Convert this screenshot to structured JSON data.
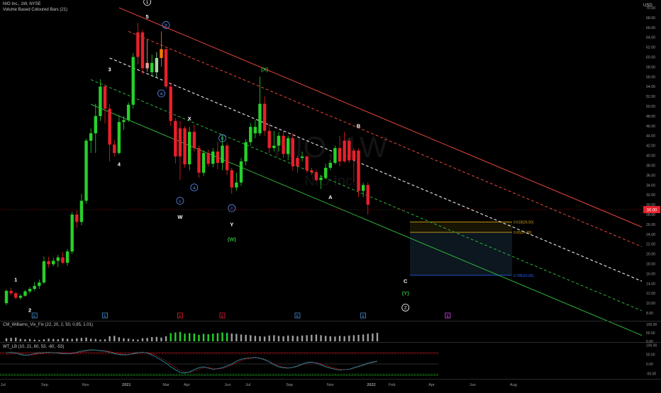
{
  "header": {
    "title": "NIO Inc., 1W, NYSE",
    "indicator": "Volume Based Coloured Bars (21)",
    "currency": "USD"
  },
  "watermark": {
    "symbol": "NIO, 1W",
    "name": "NIO Inc."
  },
  "colors": {
    "background": "#000000",
    "bull": "#26d12a",
    "bear": "#e8202a",
    "bull_pale": "#a5d6a7",
    "bear_pale": "#ef9a9a",
    "orange": "#f57c00",
    "channel_red": "#e8463c",
    "channel_white": "#ffffff",
    "channel_green": "#2fb03a",
    "fib": "#d4a017",
    "fib_blue": "#2962ff",
    "price_tag": "#e8202a"
  },
  "chart_data": {
    "type": "candlestick",
    "interval": "1W",
    "x_start": "2020-07-06",
    "y_axis": {
      "ylim": [
        7,
        71
      ],
      "ticks": [
        70,
        68,
        66,
        64,
        62,
        60,
        58,
        56,
        54,
        52,
        50,
        48,
        46,
        44,
        42,
        40,
        38,
        36,
        34,
        32,
        30,
        28,
        26,
        24,
        22,
        20,
        18,
        16,
        14,
        12,
        10,
        8
      ]
    },
    "x_axis": {
      "tick_labels": [
        {
          "label": "Jul",
          "date": "2020-07-01"
        },
        {
          "label": "Sep",
          "date": "2020-09-01"
        },
        {
          "label": "Nov",
          "date": "2020-11-01"
        },
        {
          "label": "2021",
          "date": "2021-01-01"
        },
        {
          "label": "Mar",
          "date": "2021-03-01"
        },
        {
          "label": "Apr",
          "date": "2021-04-01"
        },
        {
          "label": "Jun",
          "date": "2021-06-01"
        },
        {
          "label": "Jul",
          "date": "2021-07-01"
        },
        {
          "label": "Sep",
          "date": "2021-09-01"
        },
        {
          "label": "Nov",
          "date": "2021-11-01"
        },
        {
          "label": "2022",
          "date": "2022-01-01"
        },
        {
          "label": "Feb",
          "date": "2022-02-01"
        },
        {
          "label": "Apr",
          "date": "2022-04-01"
        },
        {
          "label": "Jun",
          "date": "2022-06-01"
        },
        {
          "label": "Aug",
          "date": "2022-08-01"
        }
      ]
    },
    "last_price": "30.00",
    "candles": [
      {
        "o": 10.0,
        "h": 12.8,
        "l": 9.6,
        "c": 12.5,
        "k": "bull"
      },
      {
        "o": 12.5,
        "h": 13.1,
        "l": 11.6,
        "c": 12.0,
        "k": "bear"
      },
      {
        "o": 12.0,
        "h": 12.3,
        "l": 10.8,
        "c": 11.1,
        "k": "bear"
      },
      {
        "o": 11.1,
        "h": 11.8,
        "l": 10.7,
        "c": 11.5,
        "k": "bull"
      },
      {
        "o": 11.5,
        "h": 12.7,
        "l": 11.3,
        "c": 12.4,
        "k": "bull"
      },
      {
        "o": 12.4,
        "h": 13.3,
        "l": 12.0,
        "c": 12.9,
        "k": "bull"
      },
      {
        "o": 12.9,
        "h": 14.3,
        "l": 12.5,
        "c": 13.5,
        "k": "bull"
      },
      {
        "o": 13.5,
        "h": 14.8,
        "l": 12.9,
        "c": 14.2,
        "k": "bull"
      },
      {
        "o": 14.2,
        "h": 19.5,
        "l": 13.9,
        "c": 18.5,
        "k": "bull"
      },
      {
        "o": 18.5,
        "h": 19.4,
        "l": 17.2,
        "c": 17.9,
        "k": "bear"
      },
      {
        "o": 17.9,
        "h": 19.2,
        "l": 17.5,
        "c": 18.6,
        "k": "bull"
      },
      {
        "o": 18.6,
        "h": 19.8,
        "l": 17.3,
        "c": 19.3,
        "k": "bull"
      },
      {
        "o": 19.3,
        "h": 20.4,
        "l": 17.9,
        "c": 18.2,
        "k": "bear"
      },
      {
        "o": 18.2,
        "h": 21.0,
        "l": 17.6,
        "c": 20.5,
        "k": "bull"
      },
      {
        "o": 20.5,
        "h": 28.5,
        "l": 20.0,
        "c": 28.0,
        "k": "bull"
      },
      {
        "o": 28.0,
        "h": 28.8,
        "l": 25.3,
        "c": 26.5,
        "k": "bear"
      },
      {
        "o": 26.5,
        "h": 32.2,
        "l": 25.8,
        "c": 30.8,
        "k": "bull"
      },
      {
        "o": 30.8,
        "h": 43.4,
        "l": 30.2,
        "c": 43.0,
        "k": "bull"
      },
      {
        "o": 43.0,
        "h": 45.5,
        "l": 40.5,
        "c": 44.5,
        "k": "bull"
      },
      {
        "o": 44.5,
        "h": 50.5,
        "l": 40.5,
        "c": 48.0,
        "k": "bull"
      },
      {
        "o": 48.0,
        "h": 55.5,
        "l": 47.0,
        "c": 54.0,
        "k": "bull"
      },
      {
        "o": 54.0,
        "h": 54.5,
        "l": 46.5,
        "c": 49.5,
        "k": "bear"
      },
      {
        "o": 49.5,
        "h": 50.5,
        "l": 38.8,
        "c": 42.2,
        "k": "bear"
      },
      {
        "o": 42.2,
        "h": 43.2,
        "l": 39.8,
        "c": 40.5,
        "k": "bear"
      },
      {
        "o": 40.5,
        "h": 48.2,
        "l": 40.2,
        "c": 46.8,
        "k": "bull"
      },
      {
        "o": 46.8,
        "h": 48.0,
        "l": 45.2,
        "c": 47.2,
        "k": "bull"
      },
      {
        "o": 47.2,
        "h": 50.8,
        "l": 46.8,
        "c": 50.3,
        "k": "bull"
      },
      {
        "o": 50.3,
        "h": 60.8,
        "l": 49.5,
        "c": 60.0,
        "k": "bull"
      },
      {
        "o": 60.0,
        "h": 66.9,
        "l": 58.5,
        "c": 65.0,
        "k": "bear"
      },
      {
        "o": 65.0,
        "h": 65.5,
        "l": 56.5,
        "c": 57.7,
        "k": "bear"
      },
      {
        "o": 57.7,
        "h": 63.5,
        "l": 57.0,
        "c": 58.8,
        "k": "pale_bear"
      },
      {
        "o": 58.8,
        "h": 60.5,
        "l": 56.0,
        "c": 56.9,
        "k": "bull"
      },
      {
        "o": 56.9,
        "h": 61.0,
        "l": 55.8,
        "c": 59.8,
        "k": "pale_bull"
      },
      {
        "o": 59.8,
        "h": 65.2,
        "l": 58.0,
        "c": 61.6,
        "k": "orange"
      },
      {
        "o": 61.6,
        "h": 61.7,
        "l": 53.6,
        "c": 54.0,
        "k": "bear"
      },
      {
        "o": 54.0,
        "h": 54.7,
        "l": 46.0,
        "c": 47.0,
        "k": "bear"
      },
      {
        "o": 47.0,
        "h": 47.6,
        "l": 38.4,
        "c": 39.8,
        "k": "bear"
      },
      {
        "o": 39.8,
        "h": 47.0,
        "l": 35.0,
        "c": 45.5,
        "k": "bear"
      },
      {
        "o": 45.5,
        "h": 46.0,
        "l": 37.5,
        "c": 38.2,
        "k": "bear"
      },
      {
        "o": 38.2,
        "h": 45.8,
        "l": 37.0,
        "c": 44.8,
        "k": "bull"
      },
      {
        "o": 44.8,
        "h": 46.3,
        "l": 40.8,
        "c": 41.5,
        "k": "bear"
      },
      {
        "o": 41.5,
        "h": 42.0,
        "l": 35.5,
        "c": 36.5,
        "k": "bear"
      },
      {
        "o": 36.5,
        "h": 41.0,
        "l": 35.8,
        "c": 40.5,
        "k": "bull"
      },
      {
        "o": 40.5,
        "h": 41.2,
        "l": 37.8,
        "c": 38.3,
        "k": "bear"
      },
      {
        "o": 38.3,
        "h": 41.5,
        "l": 37.6,
        "c": 40.8,
        "k": "bull"
      },
      {
        "o": 40.8,
        "h": 42.8,
        "l": 37.2,
        "c": 38.5,
        "k": "bear"
      },
      {
        "o": 38.5,
        "h": 44.2,
        "l": 37.0,
        "c": 42.0,
        "k": "bull"
      },
      {
        "o": 42.0,
        "h": 42.5,
        "l": 36.0,
        "c": 37.0,
        "k": "bear"
      },
      {
        "o": 37.0,
        "h": 37.5,
        "l": 32.2,
        "c": 33.5,
        "k": "bear"
      },
      {
        "o": 33.5,
        "h": 36.5,
        "l": 32.8,
        "c": 34.5,
        "k": "bull"
      },
      {
        "o": 34.5,
        "h": 39.5,
        "l": 33.8,
        "c": 38.8,
        "k": "bull"
      },
      {
        "o": 38.8,
        "h": 43.3,
        "l": 38.0,
        "c": 42.7,
        "k": "bull"
      },
      {
        "o": 42.7,
        "h": 46.6,
        "l": 42.0,
        "c": 45.8,
        "k": "bull"
      },
      {
        "o": 45.8,
        "h": 47.2,
        "l": 43.5,
        "c": 44.5,
        "k": "bull"
      },
      {
        "o": 44.5,
        "h": 56.0,
        "l": 44.0,
        "c": 50.5,
        "k": "bull"
      },
      {
        "o": 50.5,
        "h": 52.0,
        "l": 44.0,
        "c": 45.0,
        "k": "bear"
      },
      {
        "o": 45.0,
        "h": 46.5,
        "l": 40.5,
        "c": 41.5,
        "k": "bear"
      },
      {
        "o": 41.5,
        "h": 45.0,
        "l": 40.8,
        "c": 42.0,
        "k": "bull"
      },
      {
        "o": 42.0,
        "h": 44.7,
        "l": 40.8,
        "c": 44.0,
        "k": "bull"
      },
      {
        "o": 44.0,
        "h": 45.0,
        "l": 39.5,
        "c": 40.3,
        "k": "bear"
      },
      {
        "o": 40.3,
        "h": 44.0,
        "l": 39.0,
        "c": 43.5,
        "k": "bull"
      },
      {
        "o": 43.5,
        "h": 44.5,
        "l": 36.9,
        "c": 37.8,
        "k": "bear"
      },
      {
        "o": 37.8,
        "h": 40.0,
        "l": 36.5,
        "c": 39.5,
        "k": "bear"
      },
      {
        "o": 39.5,
        "h": 40.8,
        "l": 38.8,
        "c": 39.8,
        "k": "bull"
      },
      {
        "o": 39.8,
        "h": 40.0,
        "l": 36.5,
        "c": 37.0,
        "k": "bear"
      },
      {
        "o": 37.0,
        "h": 37.5,
        "l": 36.0,
        "c": 36.6,
        "k": "bear"
      },
      {
        "o": 36.6,
        "h": 37.1,
        "l": 34.8,
        "c": 35.0,
        "k": "bear"
      },
      {
        "o": 35.0,
        "h": 36.0,
        "l": 33.2,
        "c": 35.5,
        "k": "bull"
      },
      {
        "o": 35.5,
        "h": 38.3,
        "l": 35.2,
        "c": 37.5,
        "k": "bull"
      },
      {
        "o": 37.5,
        "h": 39.0,
        "l": 37.0,
        "c": 38.5,
        "k": "bull"
      },
      {
        "o": 38.5,
        "h": 42.0,
        "l": 38.2,
        "c": 41.5,
        "k": "bull"
      },
      {
        "o": 41.5,
        "h": 44.0,
        "l": 37.8,
        "c": 38.8,
        "k": "bear"
      },
      {
        "o": 38.8,
        "h": 44.8,
        "l": 38.5,
        "c": 43.0,
        "k": "bear"
      },
      {
        "o": 43.0,
        "h": 43.5,
        "l": 38.5,
        "c": 39.0,
        "k": "bear"
      },
      {
        "o": 39.0,
        "h": 41.5,
        "l": 34.5,
        "c": 41.0,
        "k": "bear"
      },
      {
        "o": 41.0,
        "h": 41.5,
        "l": 31.5,
        "c": 32.8,
        "k": "bear"
      },
      {
        "o": 32.8,
        "h": 34.5,
        "l": 31.5,
        "c": 34.0,
        "k": "bull"
      },
      {
        "o": 34.0,
        "h": 34.5,
        "l": 28.0,
        "c": 30.0,
        "k": "bear"
      }
    ],
    "channels": [
      {
        "name": "upper",
        "color": "#e8463c",
        "style": "solid",
        "y_at_0": 70.0,
        "slope_per_week": -0.4
      },
      {
        "name": "upper-mid",
        "color": "#e8463c",
        "style": "dashed",
        "y_at_0": 66.0,
        "slope_per_week": -0.4
      },
      {
        "name": "middle",
        "color": "#ffffff",
        "style": "dashed",
        "y_at_0": 59.0,
        "slope_per_week": -0.4
      },
      {
        "name": "lower-mid",
        "color": "#2fb03a",
        "style": "dashed",
        "y_at_0": 53.0,
        "slope_per_week": -0.4
      },
      {
        "name": "lower",
        "color": "#2fb03a",
        "style": "solid",
        "y_at_0": 48.0,
        "slope_per_week": -0.4
      }
    ],
    "fib_levels": [
      {
        "label": "0.618(26.50)",
        "value": 26.5,
        "color": "#d4a017"
      },
      {
        "label": "0.65(24.39)",
        "value": 24.39,
        "color": "#d4a017"
      },
      {
        "label": "0.786(15.66)",
        "value": 15.66,
        "color": "#2962ff"
      }
    ],
    "wave_labels": [
      {
        "t": "1",
        "i": 2,
        "y": 14.8,
        "c": "#ffffff",
        "s": "plain"
      },
      {
        "t": "2",
        "i": 5,
        "y": 8.6,
        "c": "#ffffff",
        "s": "plain"
      },
      {
        "t": "3",
        "i": 22,
        "y": 57.5,
        "c": "#ffffff",
        "s": "plain"
      },
      {
        "t": "4",
        "i": 24,
        "y": 38.2,
        "c": "#ffffff",
        "s": "plain"
      },
      {
        "t": "5",
        "i": 30,
        "y": 68.2,
        "c": "#ffffff",
        "s": "plain"
      },
      {
        "t": "1",
        "i": 30,
        "y": 71.2,
        "c": "#ffffff",
        "s": "circle"
      },
      {
        "t": "a",
        "i": 33,
        "y": 52.6,
        "c": "#5b8def",
        "s": "circle"
      },
      {
        "t": "b",
        "i": 34,
        "y": 66.5,
        "c": "#5b8def",
        "s": "circle"
      },
      {
        "t": "c",
        "i": 37,
        "y": 30.8,
        "c": "#5b8def",
        "s": "circle"
      },
      {
        "t": "W",
        "i": 37,
        "y": 27.5,
        "c": "#ffffff",
        "s": "plain"
      },
      {
        "t": "X",
        "i": 39,
        "y": 47.5,
        "c": "#ffffff",
        "s": "plain"
      },
      {
        "t": "a",
        "i": 40,
        "y": 33.5,
        "c": "#5b8def",
        "s": "circle"
      },
      {
        "t": "b",
        "i": 46,
        "y": 43.5,
        "c": "#5b8def",
        "s": "circle"
      },
      {
        "t": "c",
        "i": 48,
        "y": 29.3,
        "c": "#5b8def",
        "s": "circle"
      },
      {
        "t": "Y",
        "i": 48,
        "y": 26.0,
        "c": "#ffffff",
        "s": "plain"
      },
      {
        "t": "(W)",
        "i": 48,
        "y": 23.0,
        "c": "#2fb03a",
        "s": "plain"
      },
      {
        "t": "(X)",
        "i": 55,
        "y": 57.5,
        "c": "#2fb03a",
        "s": "plain"
      },
      {
        "t": "A",
        "i": 69,
        "y": 31.5,
        "c": "#ffffff",
        "s": "plain"
      },
      {
        "t": "B",
        "i": 75,
        "y": 46.0,
        "c": "#ffffff",
        "s": "plain"
      },
      {
        "t": "C",
        "i": 85,
        "y": 14.5,
        "c": "#ffffff",
        "s": "plain"
      },
      {
        "t": "(Y)",
        "i": 85,
        "y": 12.0,
        "c": "#2fb03a",
        "s": "plain"
      },
      {
        "t": "2",
        "i": 85,
        "y": 9.1,
        "c": "#ffffff",
        "s": "circle"
      }
    ],
    "event_markers": [
      {
        "i": 6,
        "t": "E",
        "c": "#4a90d9"
      },
      {
        "i": 21,
        "t": "E",
        "c": "#4a90d9"
      },
      {
        "i": 37,
        "t": "E",
        "c": "#e8202a"
      },
      {
        "i": 46,
        "t": "E",
        "c": "#e8202a"
      },
      {
        "i": 62,
        "t": "E",
        "c": "#4a90d9"
      },
      {
        "i": 76,
        "t": "E",
        "c": "#4a90d9"
      },
      {
        "i": 94,
        "t": "E",
        "c": "#e040fb"
      }
    ]
  },
  "panes": {
    "williams": {
      "title": "CM_Williams_Vix_Fix (22, 20, 2, 50, 0.85, 1.01)",
      "ylim": [
        0,
        100
      ],
      "ticks": [
        "100.00",
        "50.00",
        "0.00"
      ],
      "values": [
        18,
        20,
        22,
        14,
        12,
        14,
        10,
        8,
        12,
        16,
        14,
        12,
        18,
        15,
        14,
        18,
        20,
        22,
        15,
        14,
        10,
        12,
        30,
        32,
        24,
        18,
        16,
        12,
        10,
        18,
        20,
        25,
        26,
        22,
        30,
        48,
        52,
        55,
        45,
        48,
        46,
        38,
        44,
        42,
        46,
        48,
        52,
        50,
        46,
        44,
        40,
        38,
        36,
        32,
        30,
        28,
        34,
        36,
        32,
        30,
        34,
        33,
        30,
        34,
        36,
        38,
        40,
        36,
        32,
        30,
        28,
        32,
        30,
        34,
        36,
        38,
        40,
        44,
        46,
        50
      ],
      "highlight": [
        35,
        36,
        37,
        38,
        39,
        40,
        41,
        42,
        43,
        44,
        45,
        46,
        47
      ]
    },
    "wave_trend": {
      "title": "WT_LB (10, 21, 60, 53, -60, -53)",
      "ylim": [
        -75,
        105
      ],
      "ticks": [
        "100.00",
        "50.00",
        "0.00",
        "-50.00"
      ],
      "wt1": [
        60,
        62,
        58,
        50,
        45,
        48,
        55,
        58,
        60,
        62,
        60,
        58,
        55,
        54,
        56,
        62,
        68,
        72,
        75,
        74,
        70,
        68,
        62,
        55,
        50,
        48,
        50,
        55,
        60,
        62,
        58,
        48,
        35,
        20,
        5,
        -15,
        -30,
        -45,
        -48,
        -42,
        -30,
        -20,
        -15,
        -22,
        -28,
        -25,
        -20,
        -10,
        0,
        15,
        25,
        30,
        32,
        35,
        30,
        22,
        10,
        -5,
        -15,
        -20,
        -22,
        -18,
        -10,
        0,
        8,
        10,
        5,
        -5,
        -15,
        -22,
        -28,
        -32,
        -30,
        -28,
        -20,
        -12,
        -5,
        5,
        10,
        15
      ],
      "wt2": [
        50,
        54,
        57,
        55,
        50,
        47,
        50,
        54,
        57,
        60,
        61,
        59,
        57,
        55,
        55,
        58,
        63,
        68,
        72,
        74,
        72,
        70,
        66,
        60,
        55,
        51,
        50,
        52,
        57,
        60,
        60,
        54,
        44,
        30,
        16,
        -2,
        -18,
        -34,
        -44,
        -45,
        -38,
        -28,
        -20,
        -18,
        -24,
        -26,
        -24,
        -16,
        -6,
        6,
        18,
        26,
        30,
        33,
        32,
        26,
        16,
        2,
        -10,
        -17,
        -20,
        -19,
        -14,
        -6,
        3,
        8,
        7,
        0,
        -9,
        -17,
        -24,
        -29,
        -30,
        -28,
        -24,
        -16,
        -8,
        0,
        7,
        12
      ]
    }
  }
}
